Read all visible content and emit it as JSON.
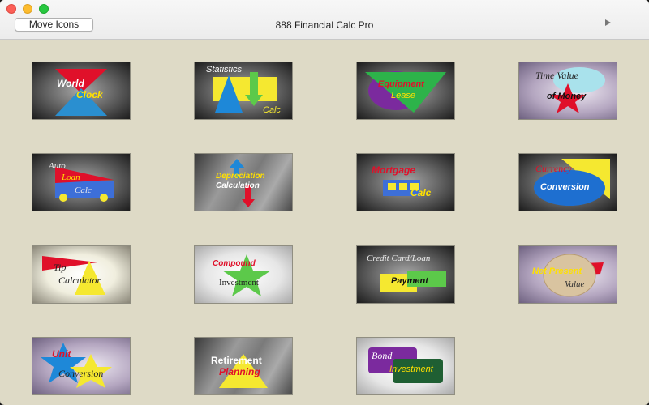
{
  "window": {
    "title": "888 Financial Calc Pro",
    "move_button_label": "Move Icons"
  },
  "icons": {
    "world_clock": [
      "World",
      "Clock"
    ],
    "statistics_calc": [
      "Statistics",
      "Calc"
    ],
    "equipment_lease": [
      "Equipment",
      "Lease"
    ],
    "time_value_money": [
      "Time Value",
      "of Money"
    ],
    "auto_loan_calc": [
      "Auto",
      "Loan",
      "Calc"
    ],
    "depreciation_calc": [
      "Depreciation",
      "Calculation"
    ],
    "mortgage_calc": [
      "Mortgage",
      "Calc"
    ],
    "currency_conversion": [
      "Currency",
      "Conversion"
    ],
    "tip_calculator": [
      "Tip",
      "Calculator"
    ],
    "compound_investment": [
      "Compound",
      "Investment"
    ],
    "credit_card_loan_payment": [
      "Credit Card/Loan",
      "Payment"
    ],
    "net_present_value": [
      "Net Present",
      "Value"
    ],
    "unit_conversion": [
      "Unit",
      "Conversion"
    ],
    "retirement_planning": [
      "Retirement",
      "Planning"
    ],
    "bond_investment": [
      "Bond",
      "Investment"
    ]
  }
}
